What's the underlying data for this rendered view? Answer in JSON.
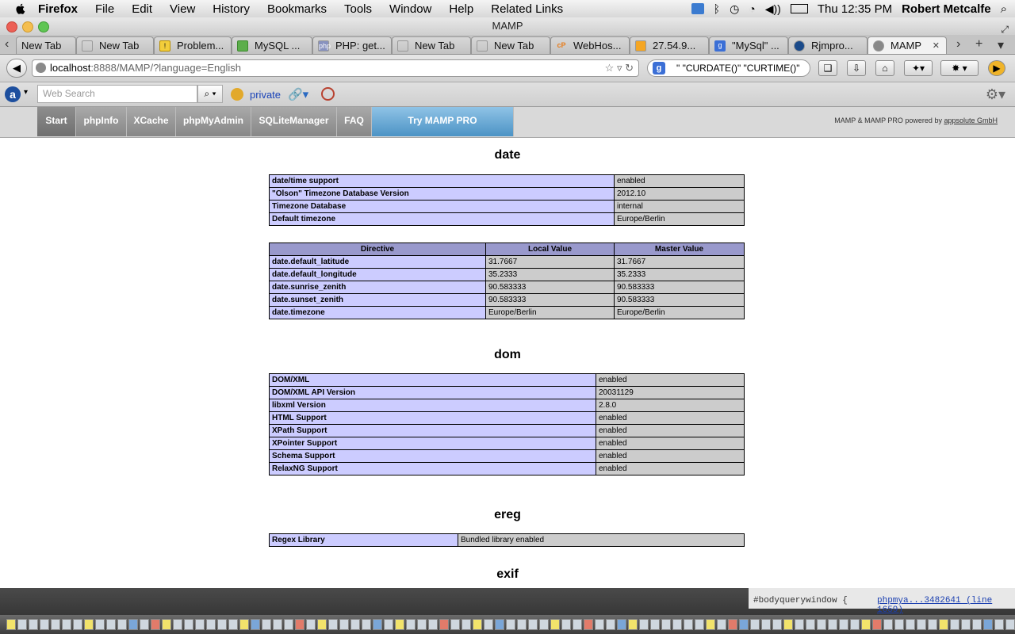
{
  "menubar": {
    "app": "Firefox",
    "items": [
      "File",
      "Edit",
      "View",
      "History",
      "Bookmarks",
      "Tools",
      "Window",
      "Help",
      "Related Links"
    ],
    "clock": "Thu 12:35 PM",
    "user": "Robert Metcalfe"
  },
  "window": {
    "title": "MAMP"
  },
  "tabs": [
    {
      "label": "New Tab",
      "icon": "page-icon"
    },
    {
      "label": "New Tab",
      "icon": "page-icon"
    },
    {
      "label": "Problem...",
      "icon": "warning-icon"
    },
    {
      "label": "MySQL ...",
      "icon": "mysql-icon"
    },
    {
      "label": "PHP: get...",
      "icon": "php-icon"
    },
    {
      "label": "New Tab",
      "icon": "page-icon"
    },
    {
      "label": "New Tab",
      "icon": "page-icon"
    },
    {
      "label": "WebHos...",
      "icon": "cpanel-icon"
    },
    {
      "label": "27.54.9...",
      "icon": "pma-icon"
    },
    {
      "label": "\"MySql\" ...",
      "icon": "google-icon"
    },
    {
      "label": "Rjmpro...",
      "icon": "wordpress-icon"
    },
    {
      "label": "MAMP",
      "icon": "globe-icon",
      "active": true
    }
  ],
  "nav": {
    "url_host": "localhost",
    "url_path": ":8888/MAMP/?language=English",
    "search_value": "\" \"CURDATE()\" \"CURTIME()\""
  },
  "addon": {
    "search_placeholder": "Web Search",
    "private_label": "private"
  },
  "mamp_nav": {
    "items": [
      "Start",
      "phpInfo",
      "XCache",
      "phpMyAdmin",
      "SQLiteManager",
      "FAQ"
    ],
    "pro_label": "Try MAMP PRO",
    "powered_text": "MAMP & MAMP PRO powered by ",
    "powered_link": "appsolute GmbH"
  },
  "sections": {
    "date": {
      "title": "date",
      "info": [
        [
          "date/time support",
          "enabled"
        ],
        [
          "\"Olson\" Timezone Database Version",
          "2012.10"
        ],
        [
          "Timezone Database",
          "internal"
        ],
        [
          "Default timezone",
          "Europe/Berlin"
        ]
      ],
      "directive_headers": [
        "Directive",
        "Local Value",
        "Master Value"
      ],
      "directives": [
        [
          "date.default_latitude",
          "31.7667",
          "31.7667"
        ],
        [
          "date.default_longitude",
          "35.2333",
          "35.2333"
        ],
        [
          "date.sunrise_zenith",
          "90.583333",
          "90.583333"
        ],
        [
          "date.sunset_zenith",
          "90.583333",
          "90.583333"
        ],
        [
          "date.timezone",
          "Europe/Berlin",
          "Europe/Berlin"
        ]
      ]
    },
    "dom": {
      "title": "dom",
      "info": [
        [
          "DOM/XML",
          "enabled"
        ],
        [
          "DOM/XML API Version",
          "20031129"
        ],
        [
          "libxml Version",
          "2.8.0"
        ],
        [
          "HTML Support",
          "enabled"
        ],
        [
          "XPath Support",
          "enabled"
        ],
        [
          "XPointer Support",
          "enabled"
        ],
        [
          "Schema Support",
          "enabled"
        ],
        [
          "RelaxNG Support",
          "enabled"
        ]
      ]
    },
    "ereg": {
      "title": "ereg",
      "info": [
        [
          "Regex Library",
          "Bundled library enabled"
        ]
      ]
    },
    "exif": {
      "title": "exif"
    }
  },
  "background_window": {
    "line1": "#bodyquerywindow {",
    "line2": "phpmya...3482641 (line 1659)"
  }
}
